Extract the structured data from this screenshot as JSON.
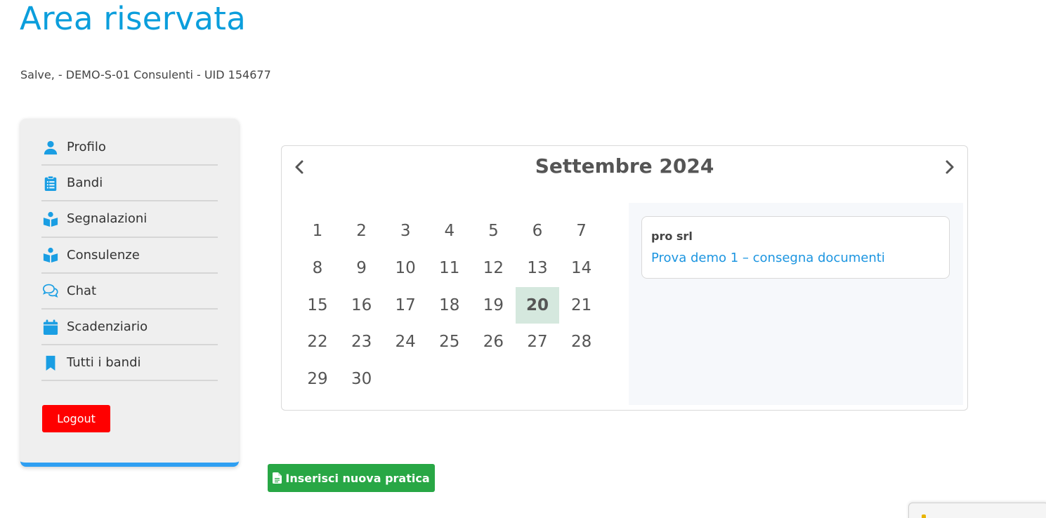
{
  "header": {
    "title": "Area riservata",
    "greeting": "Salve, - DEMO-S-01 Consulenti - UID 154677"
  },
  "sidebar": {
    "items": [
      {
        "label": "Profilo",
        "icon": "user-icon"
      },
      {
        "label": "Bandi",
        "icon": "clipboard-list-icon"
      },
      {
        "label": "Segnalazioni",
        "icon": "book-reader-icon"
      },
      {
        "label": "Consulenze",
        "icon": "book-reader-icon"
      },
      {
        "label": "Chat",
        "icon": "chat-bubbles-icon"
      },
      {
        "label": "Scadenziario",
        "icon": "calendar-icon"
      },
      {
        "label": "Tutti i bandi",
        "icon": "bookmark-icon"
      }
    ],
    "logout_label": "Logout"
  },
  "calendar": {
    "month_label": "Settembre 2024",
    "days": [
      "1",
      "2",
      "3",
      "4",
      "5",
      "6",
      "7",
      "8",
      "9",
      "10",
      "11",
      "12",
      "13",
      "14",
      "15",
      "16",
      "17",
      "18",
      "19",
      "20",
      "21",
      "22",
      "23",
      "24",
      "25",
      "26",
      "27",
      "28",
      "29",
      "30"
    ],
    "selected_day": "20",
    "events": [
      {
        "company": "pro srl",
        "title": "Prova demo 1 – consegna documenti"
      }
    ]
  },
  "actions": {
    "new_practice_label": "Inserisci nuova pratica"
  },
  "colors": {
    "accent": "#0b9edc",
    "icon": "#1a9ee3",
    "link": "#1c95e0",
    "sidebar_border": "#2f9ff2",
    "logout": "#ff0000",
    "primary_action": "#28a745",
    "selected_day": "#d5e8de"
  }
}
